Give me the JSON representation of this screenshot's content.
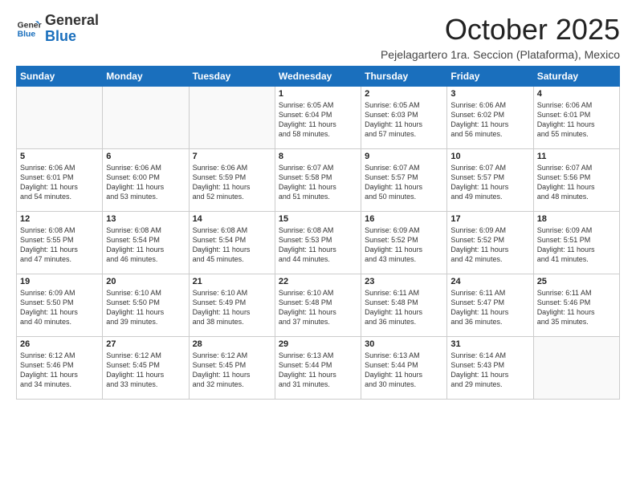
{
  "header": {
    "logo_general": "General",
    "logo_blue": "Blue",
    "month_title": "October 2025",
    "subtitle": "Pejelagartero 1ra. Seccion (Plataforma), Mexico"
  },
  "weekdays": [
    "Sunday",
    "Monday",
    "Tuesday",
    "Wednesday",
    "Thursday",
    "Friday",
    "Saturday"
  ],
  "weeks": [
    [
      {
        "day": "",
        "info": ""
      },
      {
        "day": "",
        "info": ""
      },
      {
        "day": "",
        "info": ""
      },
      {
        "day": "1",
        "info": "Sunrise: 6:05 AM\nSunset: 6:04 PM\nDaylight: 11 hours\nand 58 minutes."
      },
      {
        "day": "2",
        "info": "Sunrise: 6:05 AM\nSunset: 6:03 PM\nDaylight: 11 hours\nand 57 minutes."
      },
      {
        "day": "3",
        "info": "Sunrise: 6:06 AM\nSunset: 6:02 PM\nDaylight: 11 hours\nand 56 minutes."
      },
      {
        "day": "4",
        "info": "Sunrise: 6:06 AM\nSunset: 6:01 PM\nDaylight: 11 hours\nand 55 minutes."
      }
    ],
    [
      {
        "day": "5",
        "info": "Sunrise: 6:06 AM\nSunset: 6:01 PM\nDaylight: 11 hours\nand 54 minutes."
      },
      {
        "day": "6",
        "info": "Sunrise: 6:06 AM\nSunset: 6:00 PM\nDaylight: 11 hours\nand 53 minutes."
      },
      {
        "day": "7",
        "info": "Sunrise: 6:06 AM\nSunset: 5:59 PM\nDaylight: 11 hours\nand 52 minutes."
      },
      {
        "day": "8",
        "info": "Sunrise: 6:07 AM\nSunset: 5:58 PM\nDaylight: 11 hours\nand 51 minutes."
      },
      {
        "day": "9",
        "info": "Sunrise: 6:07 AM\nSunset: 5:57 PM\nDaylight: 11 hours\nand 50 minutes."
      },
      {
        "day": "10",
        "info": "Sunrise: 6:07 AM\nSunset: 5:57 PM\nDaylight: 11 hours\nand 49 minutes."
      },
      {
        "day": "11",
        "info": "Sunrise: 6:07 AM\nSunset: 5:56 PM\nDaylight: 11 hours\nand 48 minutes."
      }
    ],
    [
      {
        "day": "12",
        "info": "Sunrise: 6:08 AM\nSunset: 5:55 PM\nDaylight: 11 hours\nand 47 minutes."
      },
      {
        "day": "13",
        "info": "Sunrise: 6:08 AM\nSunset: 5:54 PM\nDaylight: 11 hours\nand 46 minutes."
      },
      {
        "day": "14",
        "info": "Sunrise: 6:08 AM\nSunset: 5:54 PM\nDaylight: 11 hours\nand 45 minutes."
      },
      {
        "day": "15",
        "info": "Sunrise: 6:08 AM\nSunset: 5:53 PM\nDaylight: 11 hours\nand 44 minutes."
      },
      {
        "day": "16",
        "info": "Sunrise: 6:09 AM\nSunset: 5:52 PM\nDaylight: 11 hours\nand 43 minutes."
      },
      {
        "day": "17",
        "info": "Sunrise: 6:09 AM\nSunset: 5:52 PM\nDaylight: 11 hours\nand 42 minutes."
      },
      {
        "day": "18",
        "info": "Sunrise: 6:09 AM\nSunset: 5:51 PM\nDaylight: 11 hours\nand 41 minutes."
      }
    ],
    [
      {
        "day": "19",
        "info": "Sunrise: 6:09 AM\nSunset: 5:50 PM\nDaylight: 11 hours\nand 40 minutes."
      },
      {
        "day": "20",
        "info": "Sunrise: 6:10 AM\nSunset: 5:50 PM\nDaylight: 11 hours\nand 39 minutes."
      },
      {
        "day": "21",
        "info": "Sunrise: 6:10 AM\nSunset: 5:49 PM\nDaylight: 11 hours\nand 38 minutes."
      },
      {
        "day": "22",
        "info": "Sunrise: 6:10 AM\nSunset: 5:48 PM\nDaylight: 11 hours\nand 37 minutes."
      },
      {
        "day": "23",
        "info": "Sunrise: 6:11 AM\nSunset: 5:48 PM\nDaylight: 11 hours\nand 36 minutes."
      },
      {
        "day": "24",
        "info": "Sunrise: 6:11 AM\nSunset: 5:47 PM\nDaylight: 11 hours\nand 36 minutes."
      },
      {
        "day": "25",
        "info": "Sunrise: 6:11 AM\nSunset: 5:46 PM\nDaylight: 11 hours\nand 35 minutes."
      }
    ],
    [
      {
        "day": "26",
        "info": "Sunrise: 6:12 AM\nSunset: 5:46 PM\nDaylight: 11 hours\nand 34 minutes."
      },
      {
        "day": "27",
        "info": "Sunrise: 6:12 AM\nSunset: 5:45 PM\nDaylight: 11 hours\nand 33 minutes."
      },
      {
        "day": "28",
        "info": "Sunrise: 6:12 AM\nSunset: 5:45 PM\nDaylight: 11 hours\nand 32 minutes."
      },
      {
        "day": "29",
        "info": "Sunrise: 6:13 AM\nSunset: 5:44 PM\nDaylight: 11 hours\nand 31 minutes."
      },
      {
        "day": "30",
        "info": "Sunrise: 6:13 AM\nSunset: 5:44 PM\nDaylight: 11 hours\nand 30 minutes."
      },
      {
        "day": "31",
        "info": "Sunrise: 6:14 AM\nSunset: 5:43 PM\nDaylight: 11 hours\nand 29 minutes."
      },
      {
        "day": "",
        "info": ""
      }
    ]
  ]
}
